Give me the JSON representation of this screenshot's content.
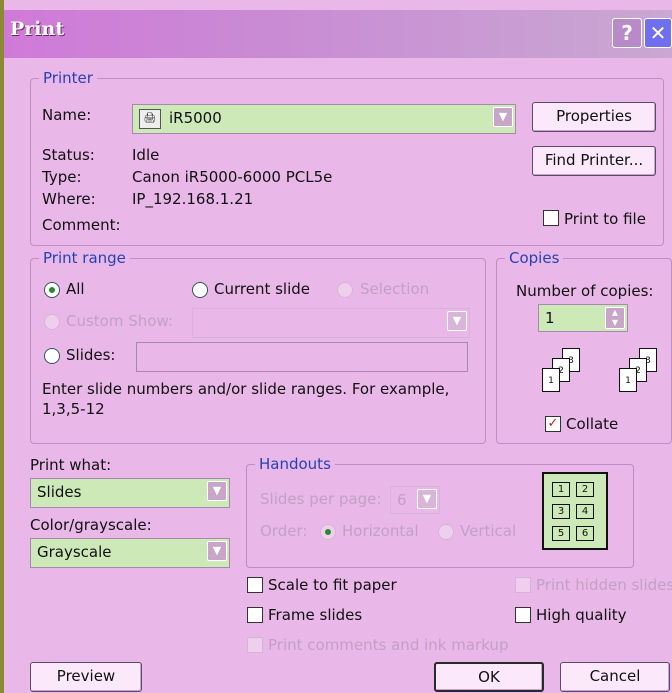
{
  "window": {
    "title": "Print",
    "help_glyph": "?",
    "close_glyph": "✕"
  },
  "printer": {
    "group_label": "Printer",
    "name_label": "Name:",
    "name_value": "iR5000",
    "status_label": "Status:",
    "status_value": "Idle",
    "type_label": "Type:",
    "type_value": "Canon iR5000-6000 PCL5e",
    "where_label": "Where:",
    "where_value": "IP_192.168.1.21",
    "comment_label": "Comment:",
    "properties_label": "Properties",
    "find_printer_label": "Find Printer...",
    "print_to_file_label": "Print to file"
  },
  "print_range": {
    "group_label": "Print range",
    "all_label": "All",
    "current_slide_label": "Current slide",
    "selection_label": "Selection",
    "custom_show_label": "Custom Show:",
    "slides_label": "Slides:",
    "help_text_line1": "Enter slide numbers and/or slide ranges. For example,",
    "help_text_line2": "1,3,5-12",
    "selected": "All"
  },
  "copies": {
    "group_label": "Copies",
    "number_label": "Number of copies:",
    "number_value": "1",
    "collate_label": "Collate",
    "collate_checked": true
  },
  "print_what": {
    "label": "Print what:",
    "value": "Slides",
    "color_label": "Color/grayscale:",
    "color_value": "Grayscale"
  },
  "handouts": {
    "group_label": "Handouts",
    "slides_per_page_label": "Slides per page:",
    "slides_per_page_value": "6",
    "order_label": "Order:",
    "horizontal_label": "Horizontal",
    "vertical_label": "Vertical"
  },
  "options": {
    "scale_to_fit_label": "Scale to fit paper",
    "frame_slides_label": "Frame slides",
    "print_comments_label": "Print comments and ink markup",
    "print_hidden_label": "Print hidden slides",
    "high_quality_label": "High quality"
  },
  "buttons": {
    "preview_label": "Preview",
    "ok_label": "OK",
    "cancel_label": "Cancel"
  },
  "colors": {
    "dialog_bg": "#e9b8e9",
    "group_title": "#2442b8",
    "combo_bg": "#cde9b8",
    "titlebar": "#d07ad8"
  }
}
